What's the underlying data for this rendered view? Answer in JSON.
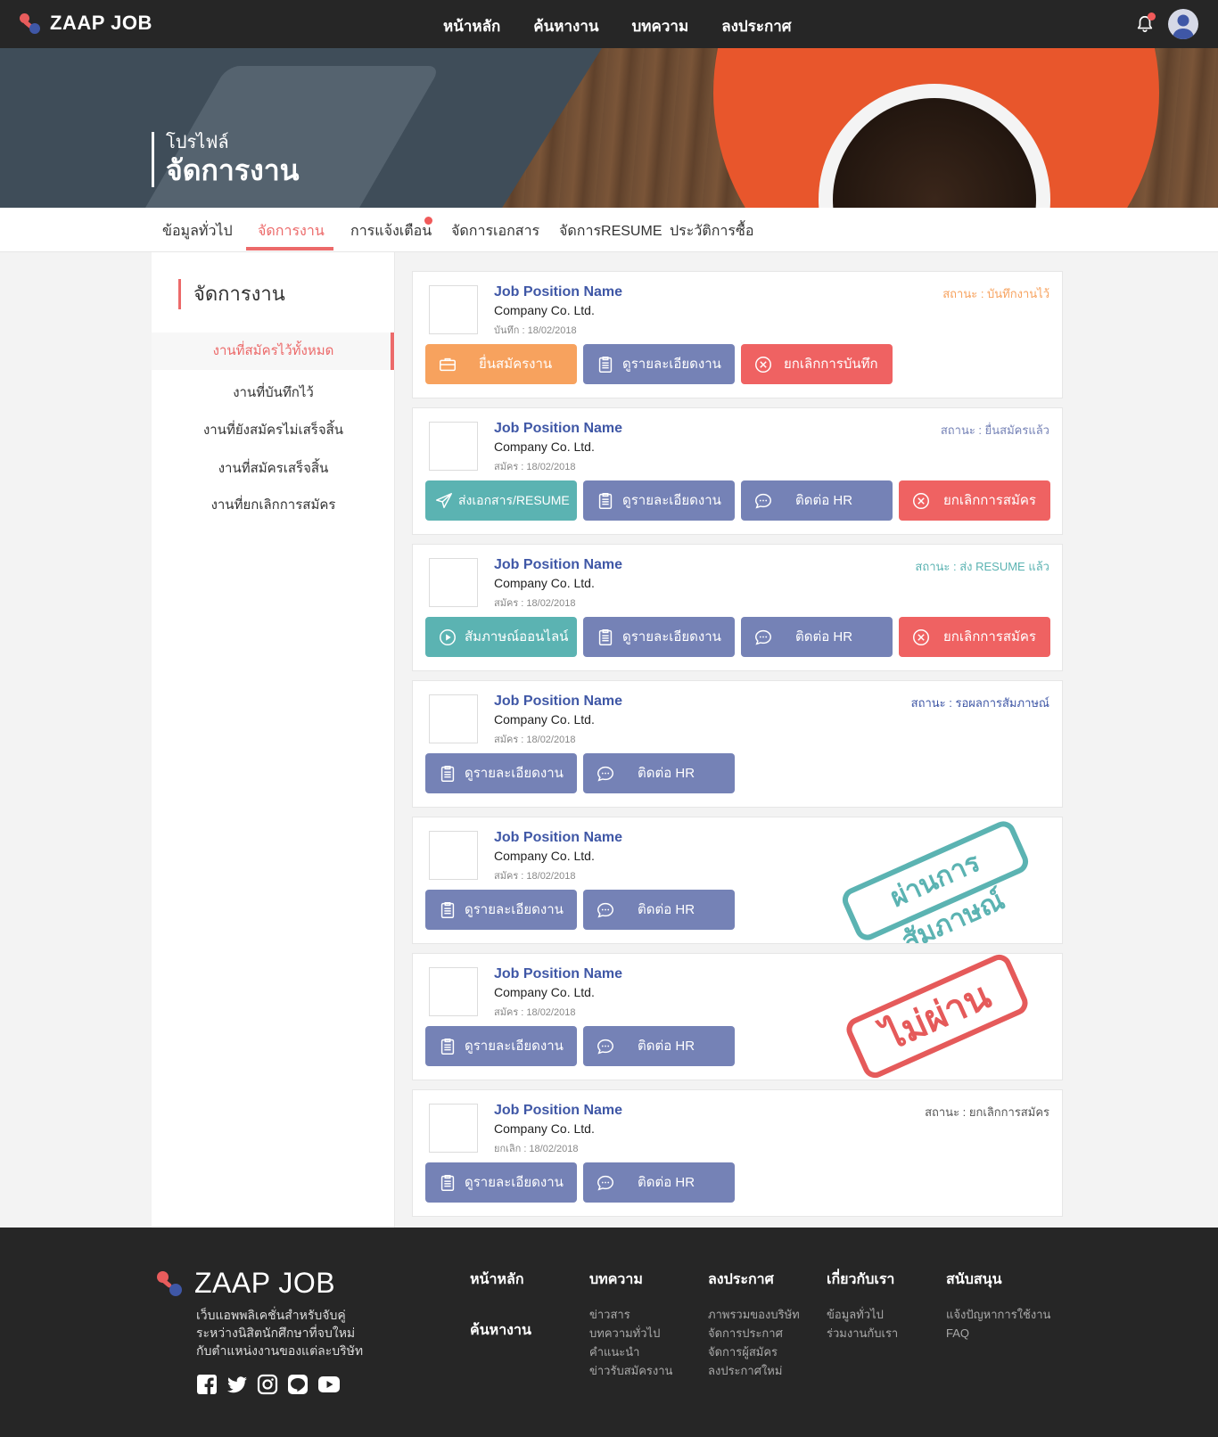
{
  "brand": {
    "name": "ZAAP JOB"
  },
  "nav": {
    "links": [
      "หน้าหลัก",
      "ค้นหางาน",
      "บทความ",
      "ลงประกาศ"
    ]
  },
  "hero": {
    "subtitle": "โปรไฟล์",
    "title": "จัดการงาน"
  },
  "tabs": [
    {
      "label": "ข้อมูลทั่วไป"
    },
    {
      "label": "จัดการงาน"
    },
    {
      "label": "การแจ้งเตือน"
    },
    {
      "label": "จัดการเอกสาร"
    },
    {
      "label": "จัดการRESUME"
    },
    {
      "label": "ประวัติการซื้อ"
    }
  ],
  "sidebar": {
    "title": "จัดการงาน",
    "items": [
      "งานที่สมัครไว้ทั้งหมด",
      "งานที่บันทึกไว้",
      "งานที่ยังสมัครไม่เสร็จสิ้น",
      "งานที่สมัครเสร็จสิ้น",
      "งานที่ยกเลิกการสมัคร"
    ]
  },
  "jobs": [
    {
      "name": "Job Position Name",
      "company": "Company Co. Ltd.",
      "date": "บันทึก : 18/02/2018",
      "status": "สถานะ : บันทึกงานไว้",
      "status_color": "#f7a25e",
      "buttons": [
        "ยื่นสมัครงาน",
        "ดูรายละเอียดงาน",
        "ยกเลิกการบันทึก"
      ]
    },
    {
      "name": "Job Position Name",
      "company": "Company Co. Ltd.",
      "date": "สมัคร : 18/02/2018",
      "status": "สถานะ : ยื่นสมัครแล้ว",
      "status_color": "#7582b6",
      "buttons": [
        "ส่งเอกสาร/RESUME",
        "ดูรายละเอียดงาน",
        "ติดต่อ HR",
        "ยกเลิกการสมัคร"
      ]
    },
    {
      "name": "Job Position Name",
      "company": "Company Co. Ltd.",
      "date": "สมัคร : 18/02/2018",
      "status": "สถานะ : ส่ง RESUME แล้ว",
      "status_color": "#5bb3b2",
      "buttons": [
        "สัมภาษณ์ออนไลน์",
        "ดูรายละเอียดงาน",
        "ติดต่อ HR",
        "ยกเลิกการสมัคร"
      ]
    },
    {
      "name": "Job Position Name",
      "company": "Company Co. Ltd.",
      "date": "สมัคร : 18/02/2018",
      "status": "สถานะ : รอผลการสัมภาษณ์",
      "status_color": "#3f57a6",
      "buttons": [
        "ดูรายละเอียดงาน",
        "ติดต่อ HR"
      ]
    },
    {
      "name": "Job Position Name",
      "company": "Company Co. Ltd.",
      "date": "สมัคร : 18/02/2018",
      "stamp": "ผ่านการสัมภาษณ์",
      "buttons": [
        "ดูรายละเอียดงาน",
        "ติดต่อ HR"
      ]
    },
    {
      "name": "Job Position Name",
      "company": "Company Co. Ltd.",
      "date": "สมัคร : 18/02/2018",
      "stamp": "ไม่ผ่าน",
      "buttons": [
        "ดูรายละเอียดงาน",
        "ติดต่อ HR"
      ]
    },
    {
      "name": "Job Position Name",
      "company": "Company Co. Ltd.",
      "date": "ยกเลิก : 18/02/2018",
      "status": "สถานะ : ยกเลิกการสมัคร",
      "status_color": "#555555",
      "buttons": [
        "ดูรายละเอียดงาน",
        "ติดต่อ HR"
      ]
    }
  ],
  "footer": {
    "brand": "ZAAP JOB",
    "desc": "เว็บแอพพลิเคชั่นสำหรับจับคู่ ระหว่างนิสิตนักศึกษาที่จบใหม่ กับตำแหน่งงานของแต่ละบริษัท",
    "home": "หน้าหลัก",
    "search": "ค้นหางาน",
    "cols": [
      {
        "heading": "บทความ",
        "items": [
          "ข่าวสาร",
          "บทความทั่วไป",
          "คำแนะนำ",
          "ข่าวรับสมัครงาน"
        ]
      },
      {
        "heading": "ลงประกาศ",
        "items": [
          "ภาพรวมของบริษัท",
          "จัดการประกาศ",
          "จัดการผู้สมัคร",
          "ลงประกาศใหม่"
        ]
      },
      {
        "heading": "เกี่ยวกับเรา",
        "items": [
          "ข้อมูลทั่วไป",
          "ร่วมงานกับเรา"
        ]
      },
      {
        "heading": "สนับสนุน",
        "items": [
          "แจ้งปัญหาการใช้งาน",
          "FAQ"
        ]
      }
    ],
    "social": [
      "facebook-icon",
      "twitter-icon",
      "instagram-icon",
      "line-icon",
      "youtube-icon"
    ]
  }
}
